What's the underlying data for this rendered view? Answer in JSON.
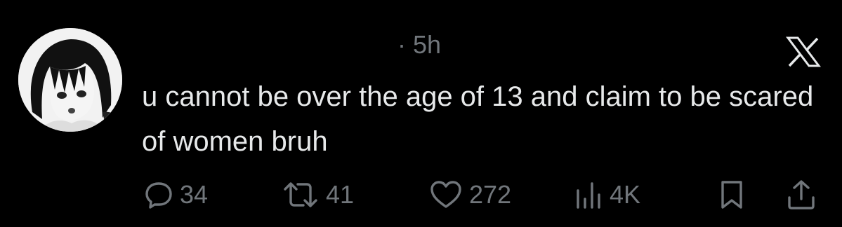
{
  "tweet": {
    "time": "· 5h",
    "text": "u cannot be over the age of 13 and claim to be scared of women bruh"
  },
  "stats": {
    "replies": "34",
    "retweets": "41",
    "likes": "272",
    "views": "4K"
  },
  "icons": {
    "logo": "x-logo-icon",
    "reply": "reply-icon",
    "retweet": "retweet-icon",
    "like": "heart-icon",
    "views": "views-chart-icon",
    "bookmark": "bookmark-icon",
    "share": "share-icon"
  },
  "colors": {
    "background": "#000000",
    "text": "#e7e9ea",
    "muted": "#71767b"
  }
}
